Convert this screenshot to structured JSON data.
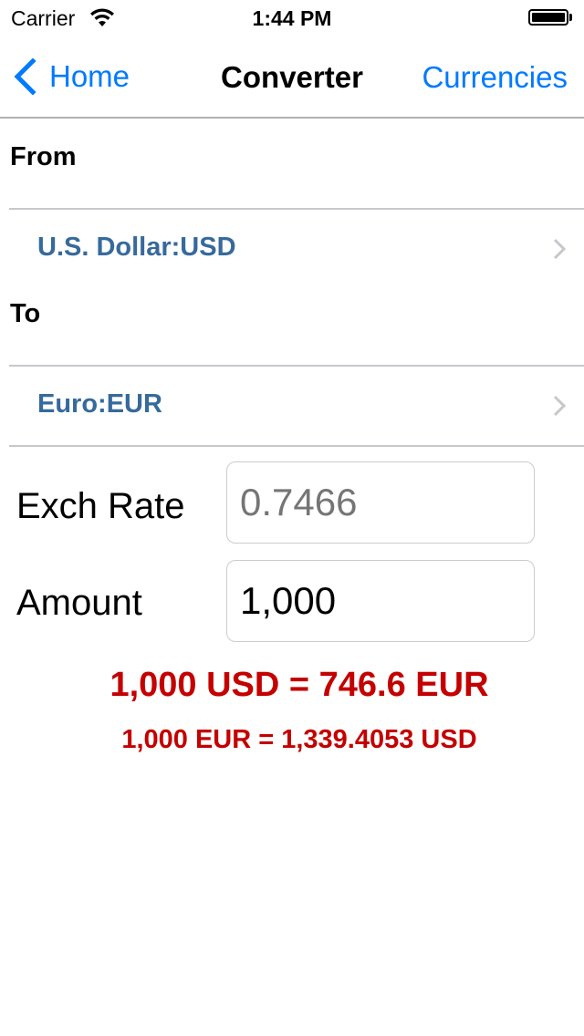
{
  "status_bar": {
    "carrier": "Carrier",
    "time": "1:44 PM",
    "wifi_icon": "wifi-icon",
    "battery_icon": "battery-icon"
  },
  "nav": {
    "back_label": "Home",
    "title": "Converter",
    "right_label": "Currencies",
    "accent_color": "#007aff"
  },
  "from": {
    "section_label": "From",
    "currency": "U.S. Dollar:USD"
  },
  "to": {
    "section_label": "To",
    "currency": "Euro:EUR"
  },
  "form": {
    "exch_rate_label": "Exch Rate",
    "exch_rate_placeholder": "0.7466",
    "amount_label": "Amount",
    "amount_value": "1,000"
  },
  "results": {
    "primary": "1,000 USD = 746.6 EUR",
    "secondary": "1,000 EUR = 1,339.4053 USD",
    "color": "#c40000"
  }
}
